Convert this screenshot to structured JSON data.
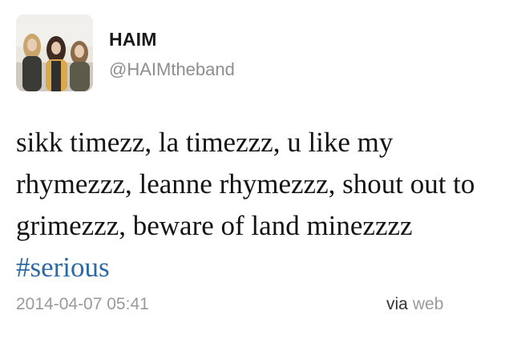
{
  "user": {
    "display_name": "HAIM",
    "handle": "@HAIMtheband",
    "avatar": "band-photo-avatar"
  },
  "tweet": {
    "text": "sikk timezz, la timezzz, u like my rhymezzz, leanne rhymezzz, shout out to grimezzz, beware of land minezzzz ",
    "hashtag": "#serious",
    "timestamp": "2014-04-07 05:41",
    "via_label": "via",
    "via_source": "web"
  },
  "colors": {
    "hashtag": "#2b6aa7",
    "meta_text": "#9a9a9a",
    "name_text": "#1a1a1a"
  }
}
